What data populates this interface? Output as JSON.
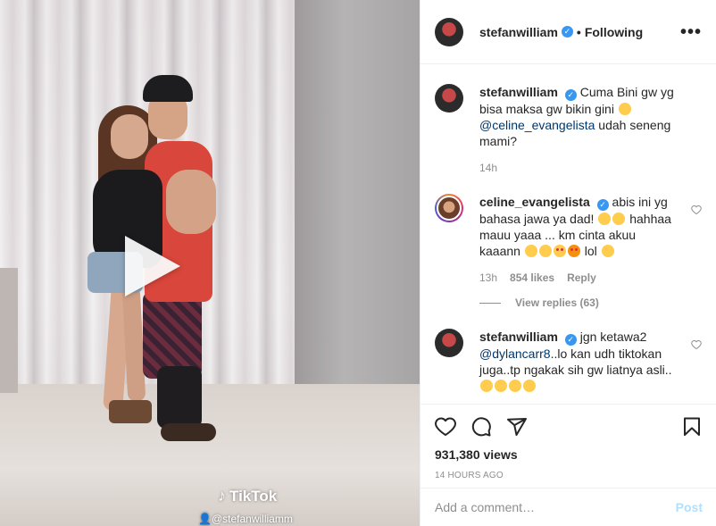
{
  "post": {
    "username": "stefanwilliam",
    "follow_state": "Following",
    "more_label": "•••"
  },
  "video": {
    "watermark": "TikTok",
    "watermark_handle": "@stefanwilliamm"
  },
  "comments": [
    {
      "username": "stefanwilliam",
      "verified": true,
      "text_before": "Cuma Bini gw yg bisa maksa gw bikin gini",
      "mention": "@celine_evangelista",
      "text_after": "udah seneng mami?",
      "time": "14h"
    },
    {
      "username": "celine_evangelista",
      "verified": true,
      "text": "abis ini yg bahasa jawa ya dad!",
      "text2": "hahhaa mauu yaaa ... km cinta akuu kaaann",
      "text3": "lol",
      "time": "13h",
      "likes": "854 likes",
      "reply": "Reply",
      "view_replies": "View replies (63)"
    },
    {
      "username": "stefanwilliam",
      "verified": true,
      "text_before": "jgn ketawa2",
      "mention": "@dylancarr8",
      "text_after": "..lo kan udh tiktokan juga..tp ngakak sih gw liatnya asli.."
    }
  ],
  "stats": {
    "views": "931,380 views",
    "time_ago": "14 HOURS AGO"
  },
  "add_comment": {
    "placeholder": "Add a comment…",
    "post_label": "Post"
  },
  "colors": {
    "verified": "#3897f0",
    "link": "#00376b",
    "muted": "#8e8e8e",
    "post_disabled": "#b2dffc",
    "shirt": "#d9463b"
  },
  "icons": [
    "play-icon",
    "verified-icon",
    "more-icon",
    "heart-icon",
    "comment-icon",
    "share-icon",
    "bookmark-icon",
    "like-comment-icon"
  ]
}
